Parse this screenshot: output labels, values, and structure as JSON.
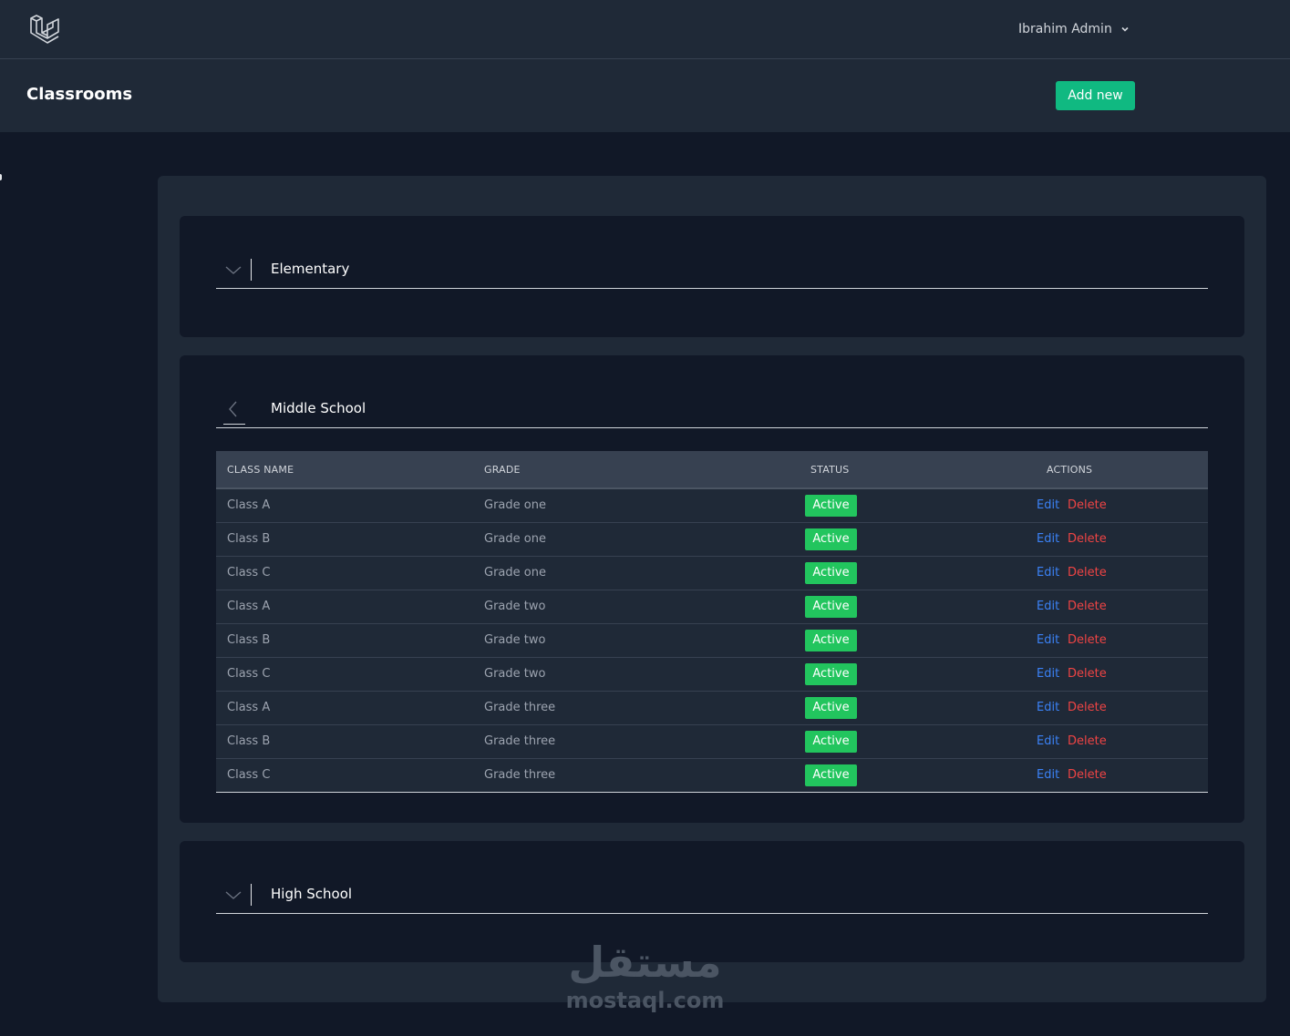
{
  "nav": {
    "logo_icon": "laravel-logo-icon",
    "user_name": "Ibrahim Admin",
    "user_menu_icon": "chevron-down-icon"
  },
  "header": {
    "title": "Classrooms",
    "add_label": "Add new",
    "add_color": "#10b981"
  },
  "sections": [
    {
      "title": "Elementary",
      "state": "collapsed",
      "icon": "chevron-down-icon"
    },
    {
      "title": "Middle School",
      "state": "expanded",
      "icon": "chevron-left-icon"
    },
    {
      "title": "High School",
      "state": "collapsed",
      "icon": "chevron-down-icon"
    }
  ],
  "table": {
    "columns": [
      "CLASS NAME",
      "GRADE",
      "STATUS",
      "ACTIONS"
    ],
    "edit_label": "Edit",
    "delete_label": "Delete",
    "rows": [
      {
        "name": "Class A",
        "grade": "Grade one",
        "status": "Active"
      },
      {
        "name": "Class B",
        "grade": "Grade one",
        "status": "Active"
      },
      {
        "name": "Class C",
        "grade": "Grade one",
        "status": "Active"
      },
      {
        "name": "Class A",
        "grade": "Grade two",
        "status": "Active"
      },
      {
        "name": "Class B",
        "grade": "Grade two",
        "status": "Active"
      },
      {
        "name": "Class C",
        "grade": "Grade two",
        "status": "Active"
      },
      {
        "name": "Class A",
        "grade": "Grade three",
        "status": "Active"
      },
      {
        "name": "Class B",
        "grade": "Grade three",
        "status": "Active"
      },
      {
        "name": "Class C",
        "grade": "Grade three",
        "status": "Active"
      }
    ]
  },
  "colors": {
    "status_active": "#22c55e",
    "edit": "#3b82f6",
    "delete": "#ef4444"
  },
  "watermark": {
    "arabic": "مستقل",
    "latin": "mostaql.com"
  }
}
